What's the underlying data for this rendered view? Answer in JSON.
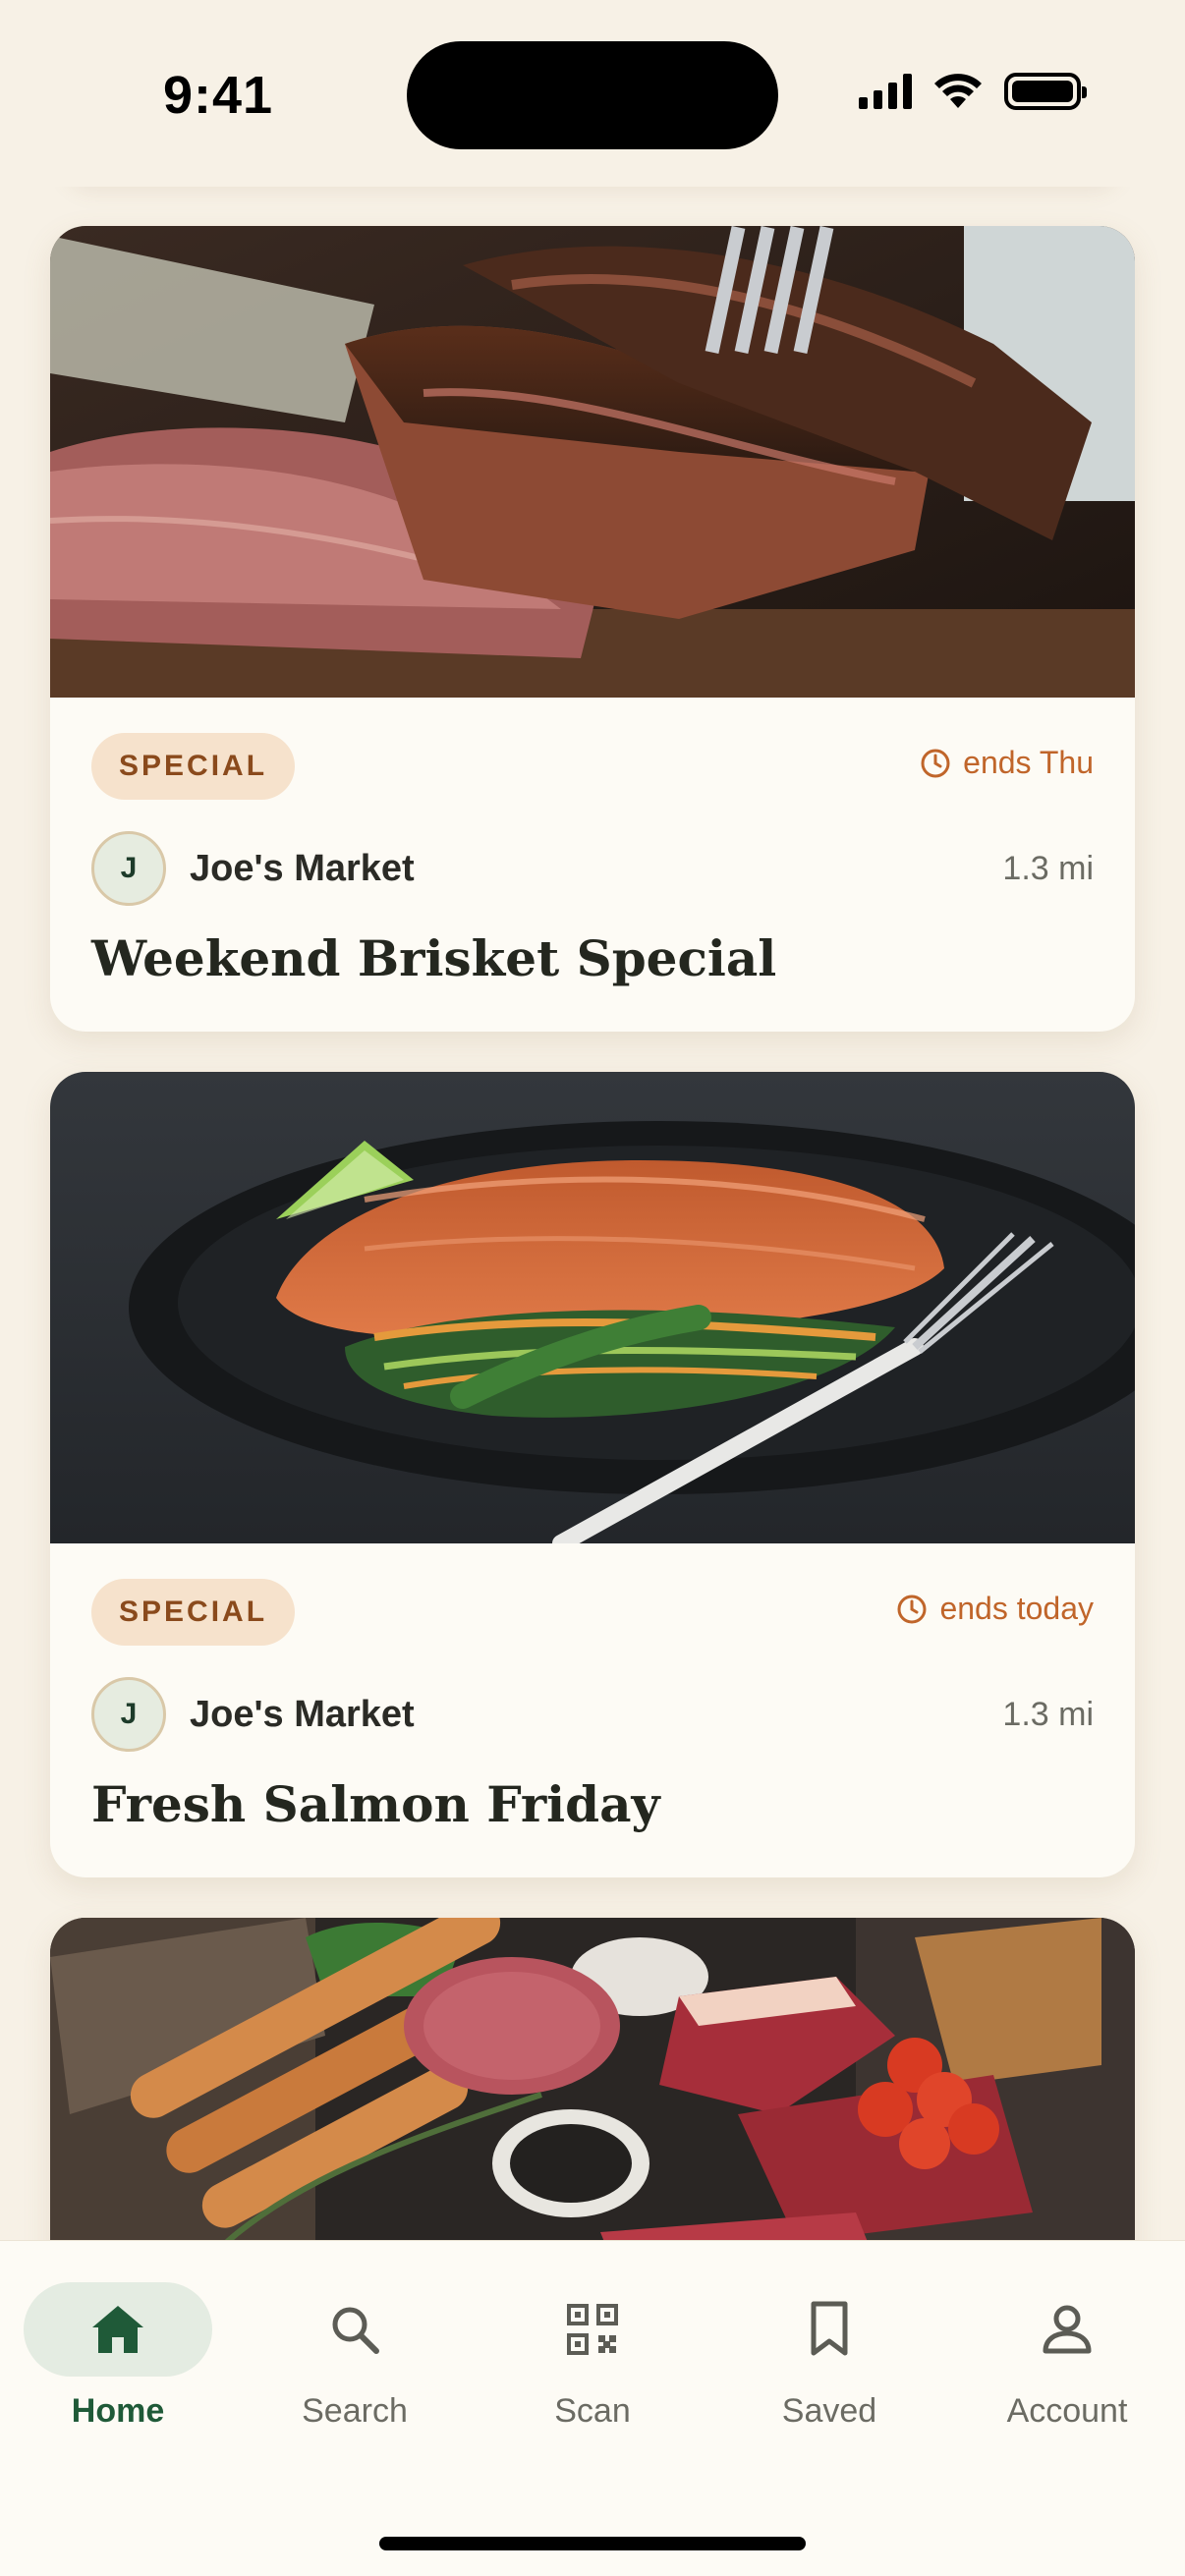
{
  "status_bar": {
    "time": "9:41"
  },
  "deals": [
    {
      "badge": "SPECIAL",
      "ends": "ends Thu",
      "store_initial": "J",
      "store_name": "Joe's Market",
      "distance": "1.3 mi",
      "title": "Weekend Brisket Special"
    },
    {
      "badge": "SPECIAL",
      "ends": "ends today",
      "store_initial": "J",
      "store_name": "Joe's Market",
      "distance": "1.3 mi",
      "title": "Fresh Salmon Friday"
    }
  ],
  "tab_bar": {
    "active": "Home",
    "tabs": [
      {
        "label": "Home",
        "icon": "home-icon"
      },
      {
        "label": "Search",
        "icon": "search-icon"
      },
      {
        "label": "Scan",
        "icon": "qr-code-icon"
      },
      {
        "label": "Saved",
        "icon": "bookmark-icon"
      },
      {
        "label": "Account",
        "icon": "person-icon"
      }
    ]
  },
  "colors": {
    "background": "#f7f1e6",
    "card": "#fdfbf5",
    "accent_green": "#1f5a38",
    "badge_bg": "#f6e2cc",
    "ends_orange": "#c0652a"
  }
}
